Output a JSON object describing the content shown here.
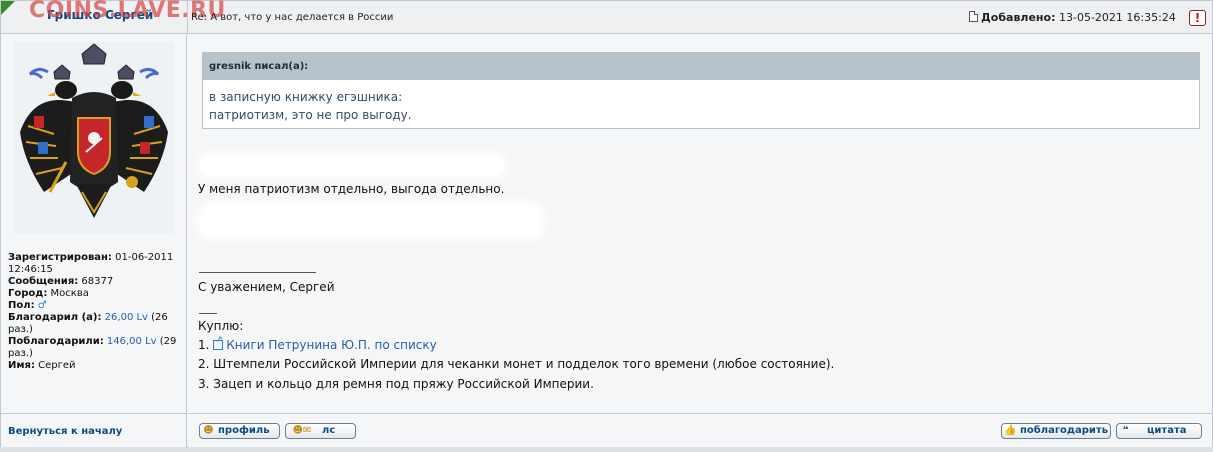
{
  "header": {
    "watermark": "COINS.LAVE.RU",
    "author": "Гришко Сергей",
    "subject": "Re: А вот, что у нас делается в России",
    "added_label": "Добавлено:",
    "added_value": "13-05-2021 16:35:24",
    "report_label": "!"
  },
  "profile": {
    "registered_label": "Зарегистрирован:",
    "registered_value": "01-06-2011 12:46:15",
    "messages_label": "Сообщения:",
    "messages_value": "68377",
    "city_label": "Город:",
    "city_value": "Москва",
    "gender_label": "Пол:",
    "gender_value": "♂",
    "thanked_label": "Благодарил (а):",
    "thanked_amount": "26,00 Lv",
    "thanked_times": "(26 раз.)",
    "was_thanked_label": "Поблагодарили:",
    "was_thanked_amount": "146,00 Lv",
    "was_thanked_times": "(29 раз.)",
    "name_label": "Имя:",
    "name_value": "Сергей"
  },
  "quote": {
    "header": "gresnik писал(а):",
    "line1": "в записную книжку егэшника:",
    "line2": "патриотизм, это не про выгоду."
  },
  "message": {
    "text": "У меня патриотизм отдельно, выгода отдельно.",
    "signature_greeting": "С уважением, Сергей",
    "buy_title": "Куплю:",
    "item1_num": "1.",
    "item1_link": "Книги Петрунина Ю.П. по списку",
    "item2": "2. Штемпели Российской Империи для чеканки монет и подделок того времени (любое состояние).",
    "item3": "3. Зацеп и кольцо для ремня под пряжу Российской Империи."
  },
  "footer": {
    "back_to_top": "Вернуться к началу",
    "profile_button": "профиль",
    "pm_button": "лс",
    "thank_button": "поблагодарить",
    "quote_button": "цитата"
  },
  "colors": {
    "link": "#2760a8",
    "author": "#0a4b84",
    "watermark": "#d74646",
    "quote_header_bg": "#b8c2cb"
  },
  "icons": [
    "document-icon",
    "report-icon",
    "external-link-icon",
    "profile-icon",
    "pm-icon",
    "thumbs-up-icon",
    "quote-icon"
  ]
}
